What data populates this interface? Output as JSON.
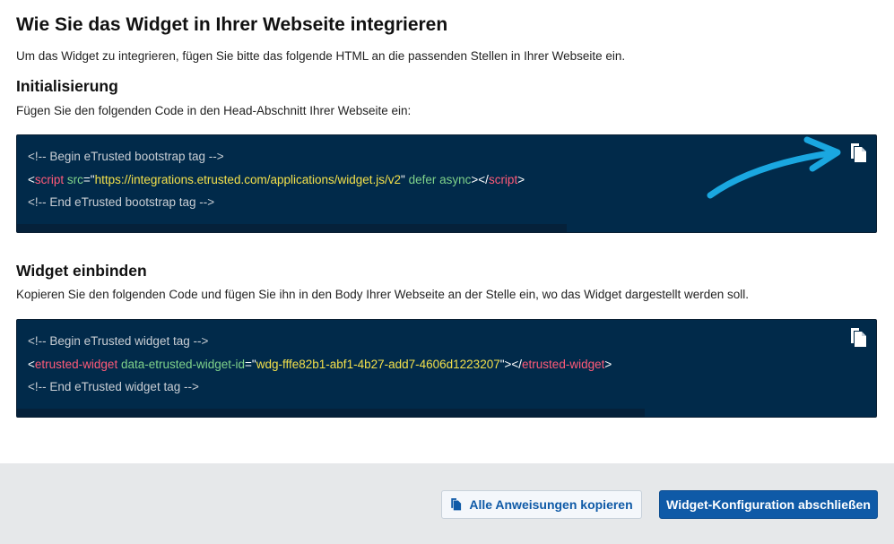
{
  "page": {
    "title": "Wie Sie das Widget in Ihrer Webseite integrieren",
    "intro": "Um das Widget zu integrieren, fügen Sie bitte das folgende HTML an die passenden Stellen in Ihrer Webseite ein."
  },
  "init": {
    "title": "Initialisierung",
    "description": "Fügen Sie den folgenden Code in den Head-Abschnitt Ihrer Webseite ein:",
    "code": {
      "comment_begin": "<!-- Begin eTrusted bootstrap tag -->",
      "open_bracket": "<",
      "tag_name": "script",
      "attr1_name": "src",
      "equals": "=\"",
      "attr1_value": "https://integrations.etrusted.com/applications/widget.js/v2",
      "close_quote": "\"",
      "attr2": "defer async",
      "tag_close_mid": "></",
      "tag_name_close": "script",
      "close_bracket": ">",
      "comment_end": "<!-- End eTrusted bootstrap tag -->"
    },
    "copy_icon": "copy-icon",
    "arrow_color": "#1aa7e0"
  },
  "embed": {
    "title": "Widget einbinden",
    "description": "Kopieren Sie den folgenden Code und fügen Sie ihn in den Body Ihrer Webseite an der Stelle ein, wo das Widget dargestellt werden soll.",
    "code": {
      "comment_begin": "<!-- Begin eTrusted widget tag -->",
      "open_bracket": "<",
      "tag_name": "etrusted-widget",
      "attr1_name": "data-etrusted-widget-id",
      "equals": "=\"",
      "attr1_value": "wdg-fffe82b1-abf1-4b27-add7-4606d1223207",
      "close_quote": "\"",
      "tag_close_mid": "></",
      "tag_name_close": "etrusted-widget",
      "close_bracket": ">",
      "comment_end": "<!-- End eTrusted widget tag -->"
    },
    "copy_icon": "copy-icon"
  },
  "footer": {
    "copy_all_label": "Alle Anweisungen kopieren",
    "finish_label": "Widget-Konfiguration abschließen"
  },
  "colors": {
    "code_bg": "#012a4a",
    "primary": "#0f5aa7",
    "tag": "#ff5a78",
    "attr": "#7fd28a",
    "string": "#f3e04a"
  }
}
